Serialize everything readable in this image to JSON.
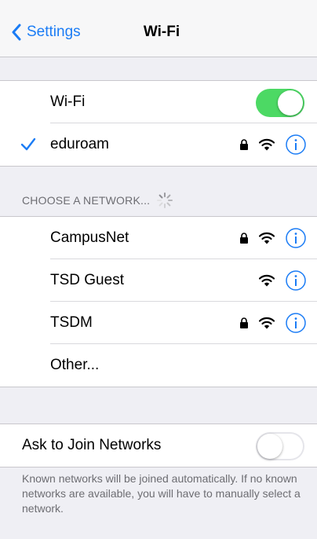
{
  "nav": {
    "back_label": "Settings",
    "title": "Wi-Fi"
  },
  "wifi_toggle": {
    "label": "Wi-Fi",
    "state": "on",
    "on_color": "#4cd964"
  },
  "connected": {
    "name": "eduroam",
    "secured": true,
    "accent": "#1b7cf5"
  },
  "choose_header": "CHOOSE A NETWORK...",
  "networks": [
    {
      "name": "CampusNet",
      "secured": true
    },
    {
      "name": "TSD Guest",
      "secured": false
    },
    {
      "name": "TSDM",
      "secured": true
    }
  ],
  "other_label": "Other...",
  "ask_to_join": {
    "label": "Ask to Join Networks",
    "state": "off"
  },
  "footer": "Known networks will be joined automatically. If no known networks are available, you will have to manually select a network."
}
